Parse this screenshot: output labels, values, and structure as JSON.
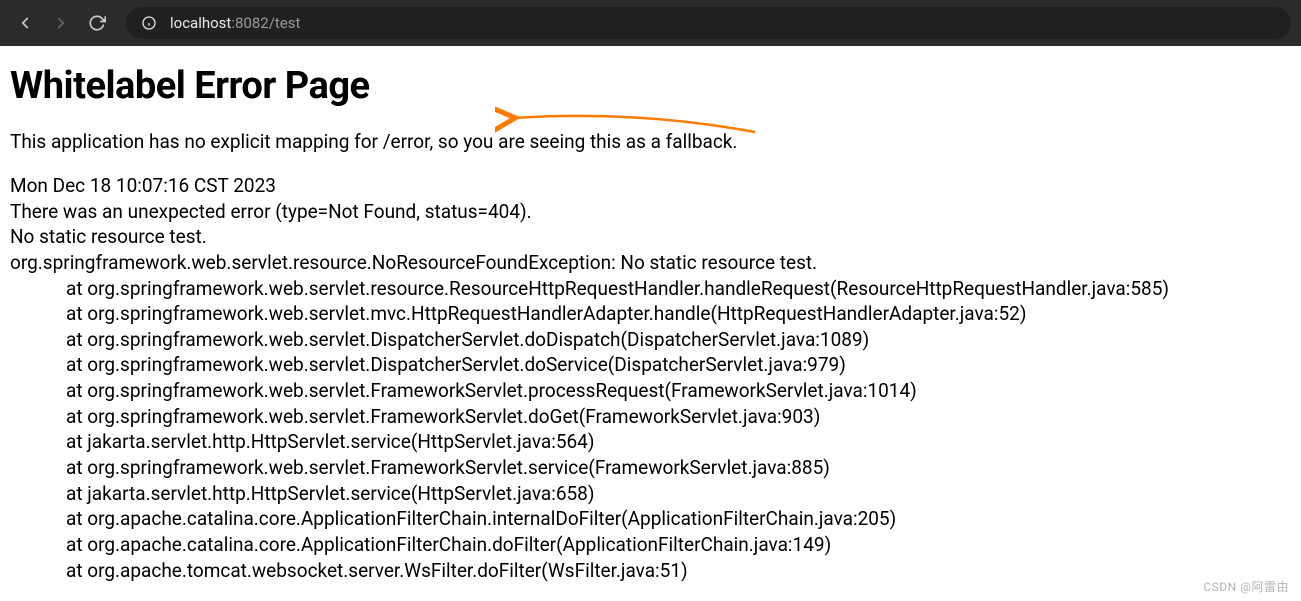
{
  "browser": {
    "url_host": "localhost",
    "url_port": ":8082",
    "url_path": "/test"
  },
  "page": {
    "title": "Whitelabel Error Page",
    "fallback_msg": "This application has no explicit mapping for /error, so you are seeing this as a fallback.",
    "timestamp": "Mon Dec 18 10:07:16 CST 2023",
    "error_line": "There was an unexpected error (type=Not Found, status=404).",
    "resource_line": "No static resource test.",
    "exception_line": "org.springframework.web.servlet.resource.NoResourceFoundException: No static resource test.",
    "trace": [
      "at org.springframework.web.servlet.resource.ResourceHttpRequestHandler.handleRequest(ResourceHttpRequestHandler.java:585)",
      "at org.springframework.web.servlet.mvc.HttpRequestHandlerAdapter.handle(HttpRequestHandlerAdapter.java:52)",
      "at org.springframework.web.servlet.DispatcherServlet.doDispatch(DispatcherServlet.java:1089)",
      "at org.springframework.web.servlet.DispatcherServlet.doService(DispatcherServlet.java:979)",
      "at org.springframework.web.servlet.FrameworkServlet.processRequest(FrameworkServlet.java:1014)",
      "at org.springframework.web.servlet.FrameworkServlet.doGet(FrameworkServlet.java:903)",
      "at jakarta.servlet.http.HttpServlet.service(HttpServlet.java:564)",
      "at org.springframework.web.servlet.FrameworkServlet.service(FrameworkServlet.java:885)",
      "at jakarta.servlet.http.HttpServlet.service(HttpServlet.java:658)",
      "at org.apache.catalina.core.ApplicationFilterChain.internalDoFilter(ApplicationFilterChain.java:205)",
      "at org.apache.catalina.core.ApplicationFilterChain.doFilter(ApplicationFilterChain.java:149)",
      "at org.apache.tomcat.websocket.server.WsFilter.doFilter(WsFilter.java:51)"
    ]
  },
  "watermark": "CSDN @阿雷由"
}
